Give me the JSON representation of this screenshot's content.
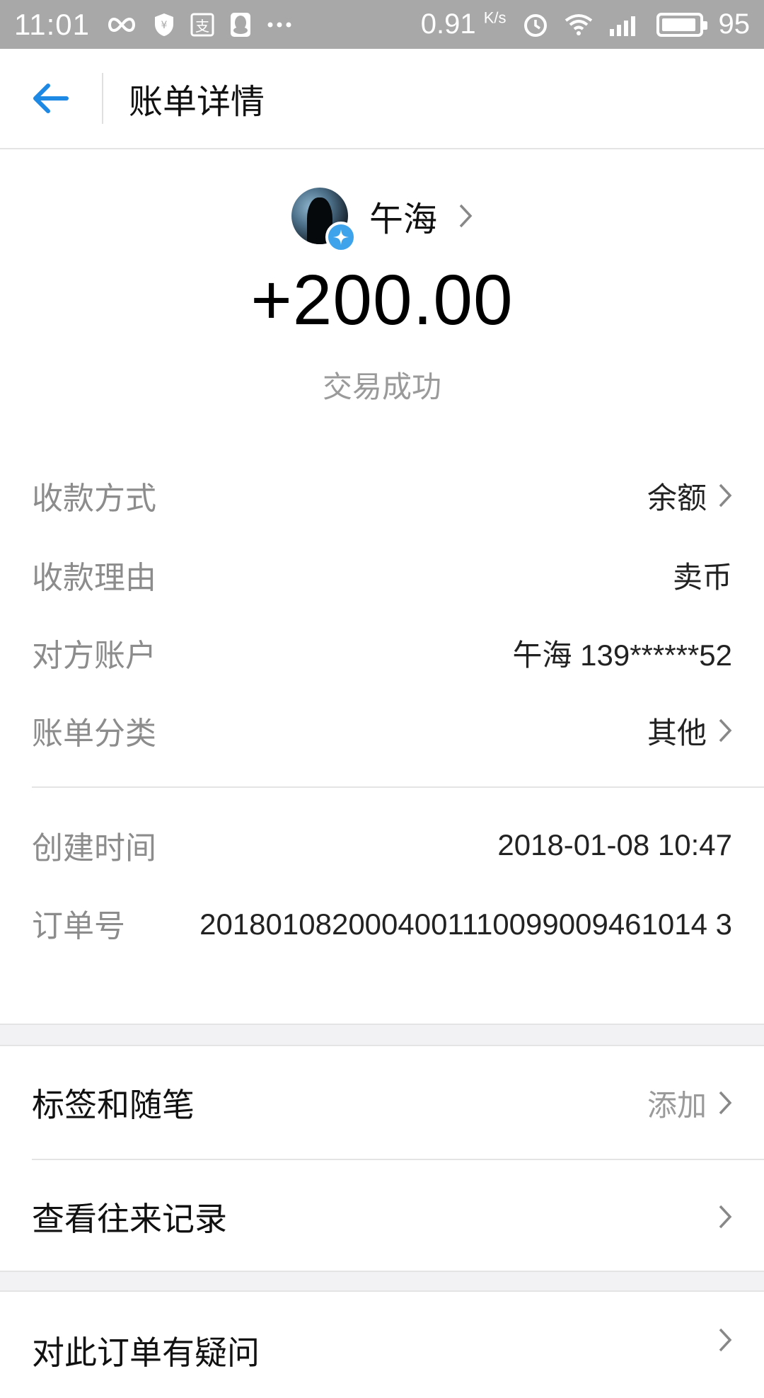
{
  "status_bar": {
    "time": "11:01",
    "speed_value": "0.91",
    "speed_unit": "K/s",
    "battery": "95",
    "icons": [
      "infinity-icon",
      "shield-yen-icon",
      "alipay-icon",
      "qq-icon",
      "more-dots-icon",
      "alarm-icon",
      "wifi-icon",
      "signal-icon",
      "battery-icon"
    ]
  },
  "nav": {
    "title": "账单详情",
    "back_icon": "arrow-left-icon"
  },
  "header": {
    "payer_name": "午海",
    "amount": "+200.00",
    "status": "交易成功"
  },
  "details": [
    {
      "label": "收款方式",
      "value": "余额",
      "has_chevron": true
    },
    {
      "label": "收款理由",
      "value": "卖币",
      "has_chevron": false
    },
    {
      "label": "对方账户",
      "value": "午海 139******52",
      "has_chevron": false
    },
    {
      "label": "账单分类",
      "value": "其他",
      "has_chevron": true
    }
  ],
  "meta": {
    "created_label": "创建时间",
    "created_value": "2018-01-08 10:47",
    "order_label": "订单号",
    "order_value": "2018010820004001110099009461014 3"
  },
  "actions": {
    "tags_label": "标签和随笔",
    "tags_hint": "添加",
    "history_label": "查看往来记录",
    "question_label": "对此订单有疑问"
  },
  "colors": {
    "accent": "#1e88e5",
    "status_bar": "#a8a8a8",
    "secondary_text": "#8c8c8c",
    "band": "#f2f2f4"
  }
}
